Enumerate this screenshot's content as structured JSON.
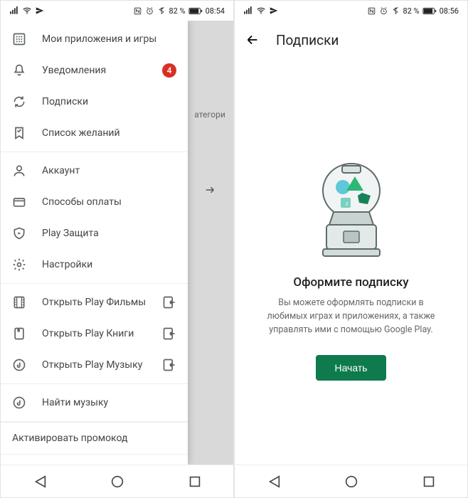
{
  "left": {
    "status": {
      "time": "08:54",
      "battery": "82 %"
    },
    "menu": {
      "section1": [
        {
          "label": "Мои приложения и игры",
          "icon": "apps"
        },
        {
          "label": "Уведомления",
          "icon": "bell",
          "badge": "4"
        },
        {
          "label": "Подписки",
          "icon": "refresh"
        },
        {
          "label": "Список желаний",
          "icon": "bookmark"
        }
      ],
      "section2": [
        {
          "label": "Аккаунт",
          "icon": "user"
        },
        {
          "label": "Способы оплаты",
          "icon": "card"
        },
        {
          "label": "Play Защита",
          "icon": "shield"
        },
        {
          "label": "Настройки",
          "icon": "gear"
        }
      ],
      "section3": [
        {
          "label": "Открыть Play Фильмы",
          "icon": "film",
          "open": true
        },
        {
          "label": "Открыть Play Книги",
          "icon": "book",
          "open": true
        },
        {
          "label": "Открыть Play Музыку",
          "icon": "music",
          "open": true
        }
      ],
      "section4": [
        {
          "label": "Найти музыку",
          "icon": "music"
        }
      ],
      "promo": "Активировать промокод"
    },
    "bg": {
      "cat": "атегори"
    }
  },
  "right": {
    "status": {
      "time": "08:56",
      "battery": "82 %"
    },
    "title": "Подписки",
    "empty": {
      "title": "Оформите подписку",
      "desc": "Вы можете оформлять подписки в любимых играх и приложениях, а также управлять ими с помощью Google Play.",
      "button": "Начать"
    }
  }
}
